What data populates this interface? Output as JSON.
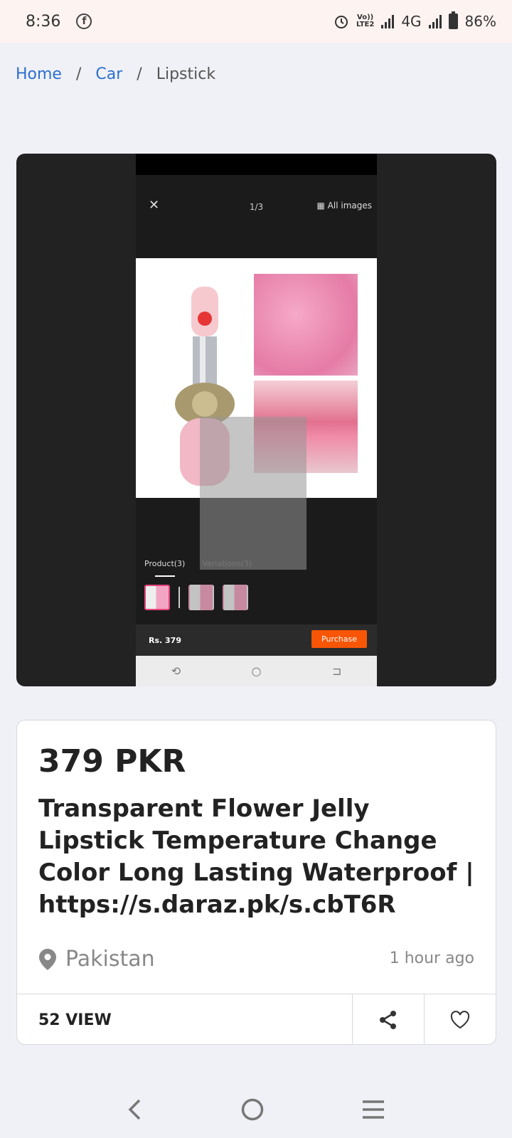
{
  "status_bar": {
    "time": "8:36",
    "volte_top": "Vo))",
    "volte_bottom": "LTE2",
    "network": "4G",
    "battery": "86%"
  },
  "breadcrumb": {
    "home": "Home",
    "separator": "/",
    "category": "Car",
    "current": "Lipstick"
  },
  "screenshot": {
    "counter": "1/3",
    "all_images": "All images",
    "tab_product": "Product(3)",
    "tab_variations": "Variations(3)",
    "price": "Rs. 379",
    "purchase": "Purchase"
  },
  "listing": {
    "price": "379 PKR",
    "title": "Transparent Flower Jelly Lipstick Temperature Change Color Long Lasting Waterproof | https://s.daraz.pk/s.cbT6R",
    "location": "Pakistan",
    "posted": "1 hour ago",
    "views": "52 VIEW"
  },
  "icons": {
    "share": "share-icon",
    "favorite": "heart-icon",
    "location": "map-pin-icon"
  },
  "colors": {
    "link": "#2c6fcf",
    "accent": "#f85606",
    "background": "#f0f1f6"
  }
}
